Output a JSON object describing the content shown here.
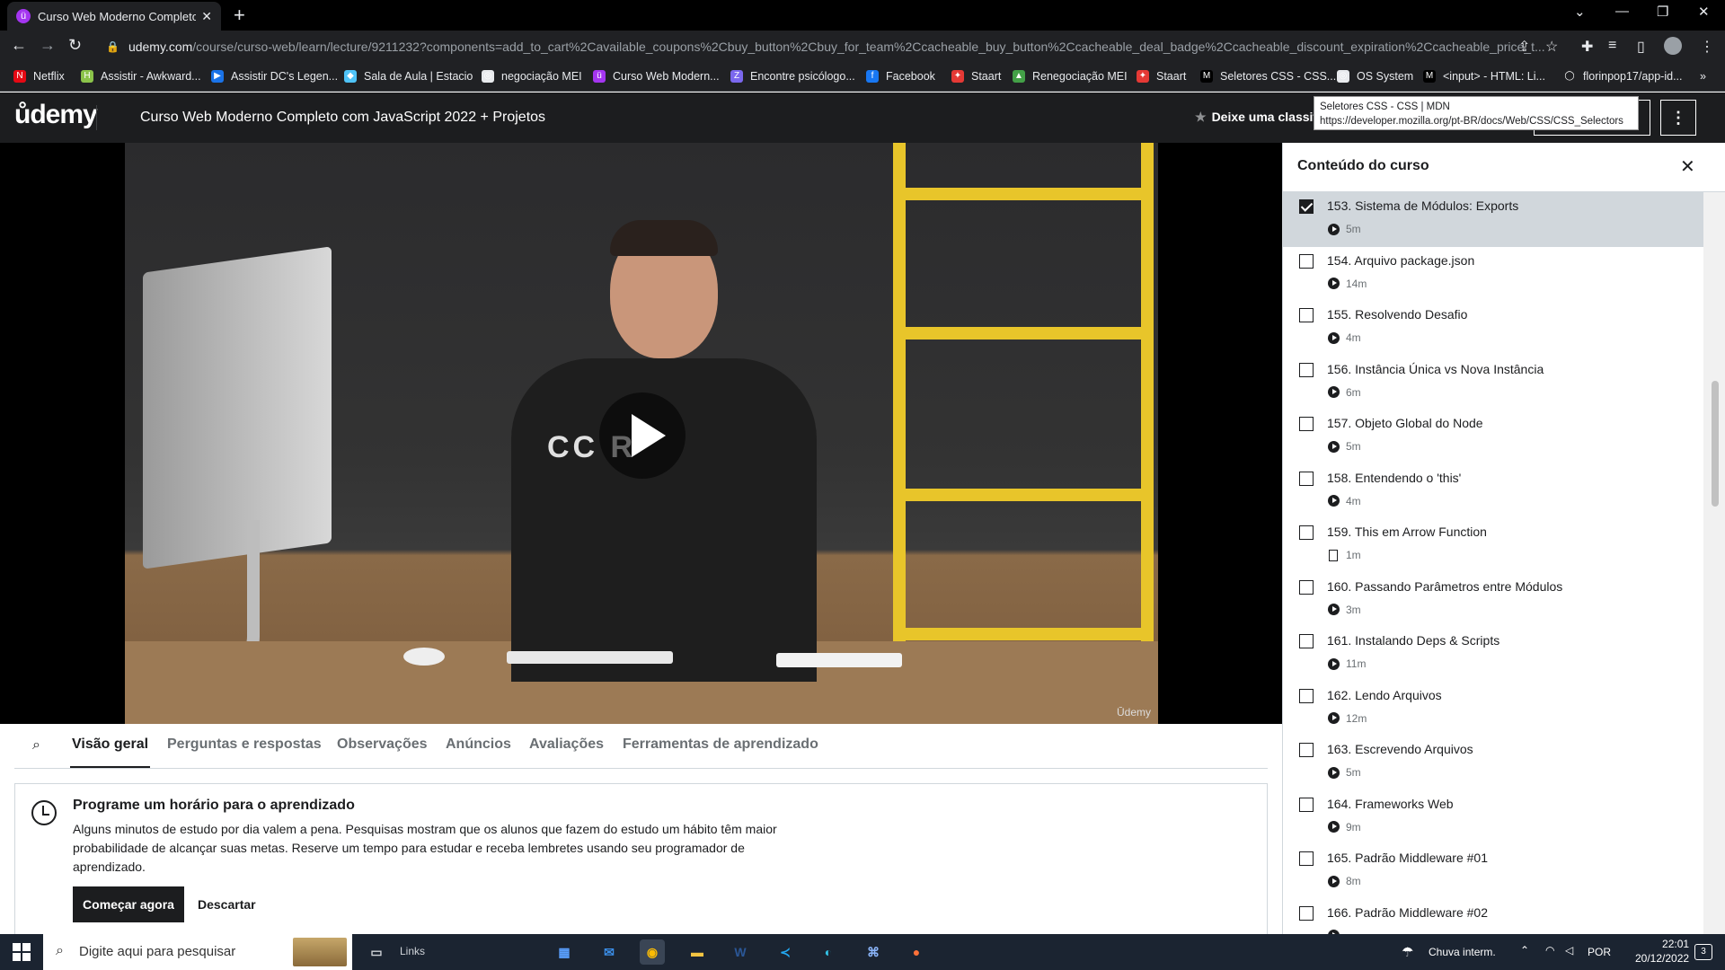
{
  "browser": {
    "tab_title": "Curso Web Moderno Completo c",
    "tab_favicon": "ü",
    "new_tab": "+",
    "url_host": "udemy.com",
    "url_path": "/course/curso-web/learn/lecture/9211232?components=add_to_cart%2Cavailable_coupons%2Cbuy_button%2Cbuy_for_team%2Ccacheable_buy_button%2Ccacheable_deal_badge%2Ccacheable_discount_expiration%2Ccacheable_price_t...",
    "tooltip": {
      "title": "Seletores CSS - CSS | MDN",
      "url": "https://developer.mozilla.org/pt-BR/docs/Web/CSS/CSS_Selectors"
    },
    "bookmarks": [
      {
        "label": "Netflix",
        "color": "#e50914",
        "glyph": "N"
      },
      {
        "label": "Assistir - Awkward...",
        "color": "#8bc34a",
        "glyph": "H"
      },
      {
        "label": "Assistir DC's Legen...",
        "color": "#1a73e8",
        "glyph": "▶"
      },
      {
        "label": "Sala de Aula | Estacio",
        "color": "#4fc3f7",
        "glyph": "◆"
      },
      {
        "label": "negociação MEI",
        "color": "#e8eaed",
        "glyph": "◎"
      },
      {
        "label": "Curso Web Modern...",
        "color": "#a435f0",
        "glyph": "ü"
      },
      {
        "label": "Encontre psicólogo...",
        "color": "#7b68ee",
        "glyph": "Z"
      },
      {
        "label": "Facebook",
        "color": "#1877f2",
        "glyph": "f"
      },
      {
        "label": "Staart",
        "color": "#e53935",
        "glyph": "✦"
      },
      {
        "label": "Renegociação MEI",
        "color": "#43a047",
        "glyph": "▲"
      },
      {
        "label": "Staart",
        "color": "#e53935",
        "glyph": "✦"
      },
      {
        "label": "Seletores CSS - CSS...",
        "color": "#000000",
        "glyph": "M"
      },
      {
        "label": "OS System",
        "color": "#e8eaed",
        "glyph": "◎"
      },
      {
        "label": "<input> - HTML: Li...",
        "color": "#000000",
        "glyph": "M"
      },
      {
        "label": "florinpop17/app-id...",
        "color": "#202124",
        "glyph": "◯"
      }
    ],
    "bookmarks_overflow": "»"
  },
  "header": {
    "logo": "ůdemy",
    "course_title": "Curso Web Moderno Completo com JavaScript 2022 + Projetos",
    "rate_label": "Deixe uma classificação",
    "more_icon": "⋮"
  },
  "video": {
    "watermark": "Ūdemy",
    "shirt_text": "CC   R"
  },
  "content_tabs": [
    {
      "label": "Visão geral",
      "active": true
    },
    {
      "label": "Perguntas e respostas",
      "active": false
    },
    {
      "label": "Observações",
      "active": false
    },
    {
      "label": "Anúncios",
      "active": false
    },
    {
      "label": "Avaliações",
      "active": false
    },
    {
      "label": "Ferramentas de aprendizado",
      "active": false
    }
  ],
  "schedule_card": {
    "title": "Programe um horário para o aprendizado",
    "body": "Alguns minutos de estudo por dia valem a pena. Pesquisas mostram que os alunos que fazem do estudo um hábito têm maior probabilidade de alcançar suas metas. Reserve um tempo para estudar e receba lembretes usando seu programador de aprendizado.",
    "primary": "Começar agora",
    "secondary": "Descartar"
  },
  "sidebar": {
    "title": "Conteúdo do curso",
    "close": "✕",
    "lessons": [
      {
        "title": "153. Sistema de Módulos: Exports",
        "duration": "5m",
        "type": "video",
        "checked": true,
        "current": true
      },
      {
        "title": "154. Arquivo package.json",
        "duration": "14m",
        "type": "video",
        "checked": false,
        "current": false
      },
      {
        "title": "155. Resolvendo Desafio",
        "duration": "4m",
        "type": "video",
        "checked": false,
        "current": false
      },
      {
        "title": "156. Instância Única vs Nova Instância",
        "duration": "6m",
        "type": "video",
        "checked": false,
        "current": false
      },
      {
        "title": "157. Objeto Global do Node",
        "duration": "5m",
        "type": "video",
        "checked": false,
        "current": false
      },
      {
        "title": "158. Entendendo o 'this'",
        "duration": "4m",
        "type": "video",
        "checked": false,
        "current": false
      },
      {
        "title": "159. This em Arrow Function",
        "duration": "1m",
        "type": "file",
        "checked": false,
        "current": false
      },
      {
        "title": "160. Passando Parâmetros entre Módulos",
        "duration": "3m",
        "type": "video",
        "checked": false,
        "current": false
      },
      {
        "title": "161. Instalando Deps & Scripts",
        "duration": "11m",
        "type": "video",
        "checked": false,
        "current": false
      },
      {
        "title": "162. Lendo Arquivos",
        "duration": "12m",
        "type": "video",
        "checked": false,
        "current": false
      },
      {
        "title": "163. Escrevendo Arquivos",
        "duration": "5m",
        "type": "video",
        "checked": false,
        "current": false
      },
      {
        "title": "164. Frameworks Web",
        "duration": "9m",
        "type": "video",
        "checked": false,
        "current": false
      },
      {
        "title": "165. Padrão Middleware #01",
        "duration": "8m",
        "type": "video",
        "checked": false,
        "current": false
      },
      {
        "title": "166. Padrão Middleware #02",
        "duration": "",
        "type": "video",
        "checked": false,
        "current": false
      }
    ]
  },
  "taskbar": {
    "search_placeholder": "Digite aqui para pesquisar",
    "links": "Links",
    "weather": "Chuva interm.",
    "lang": "POR",
    "time": "22:01",
    "date": "20/12/2022",
    "notifications": "3"
  }
}
